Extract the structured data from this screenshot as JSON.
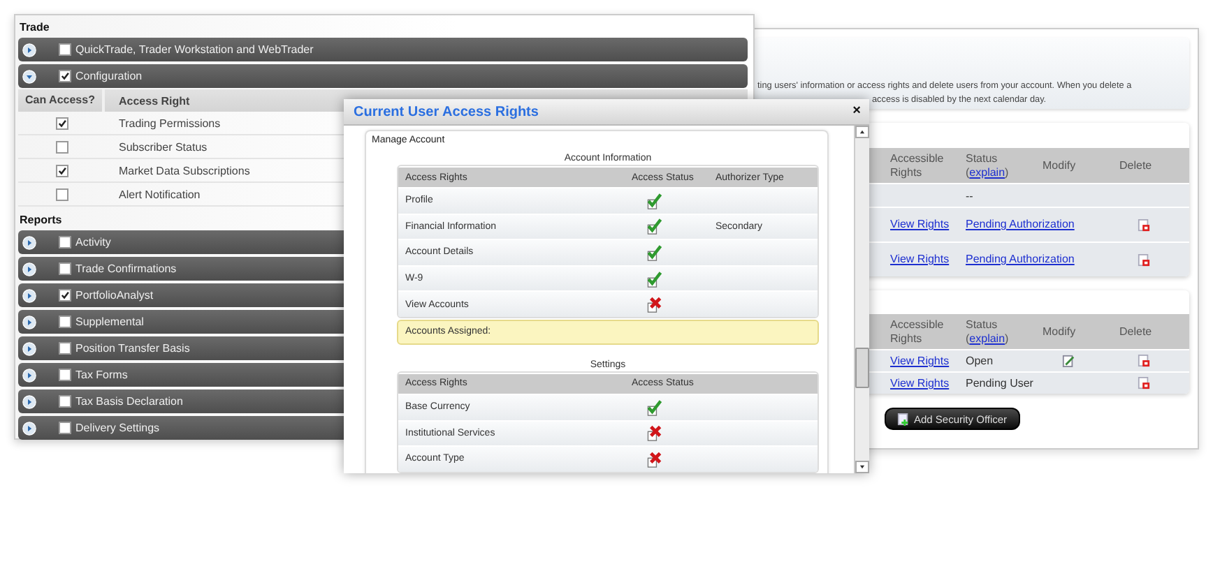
{
  "permissions_panel": {
    "sections": [
      {
        "title": "Trade",
        "groups": [
          {
            "label": "QuickTrade, Trader Workstation and WebTrader",
            "checked": false,
            "expanded": false
          },
          {
            "label": "Configuration",
            "checked": true,
            "expanded": true,
            "columns": [
              "Can Access?",
              "Access Right"
            ],
            "rights": [
              {
                "label": "Trading Permissions",
                "checked": true
              },
              {
                "label": "Subscriber Status",
                "checked": false
              },
              {
                "label": "Market Data Subscriptions",
                "checked": true
              },
              {
                "label": "Alert Notification",
                "checked": false
              }
            ]
          }
        ]
      },
      {
        "title": "Reports",
        "groups": [
          {
            "label": "Activity",
            "checked": false,
            "expanded": false
          },
          {
            "label": "Trade Confirmations",
            "checked": false,
            "expanded": false
          },
          {
            "label": "PortfolioAnalyst",
            "checked": true,
            "expanded": false
          },
          {
            "label": "Supplemental",
            "checked": false,
            "expanded": false
          },
          {
            "label": "Position Transfer Basis",
            "checked": false,
            "expanded": false
          },
          {
            "label": "Tax Forms",
            "checked": false,
            "expanded": false
          },
          {
            "label": "Tax Basis Declaration",
            "checked": false,
            "expanded": false
          },
          {
            "label": "Delivery Settings",
            "checked": false,
            "expanded": false
          }
        ]
      }
    ]
  },
  "users_panel": {
    "intro_lines": [
      "ting users' information or access rights and delete users from your account. When you delete a",
      "access is disabled by the next calendar day."
    ],
    "tables": [
      {
        "columns": [
          {
            "label": "Accessible Rights"
          },
          {
            "label": "Status",
            "link_before": "(",
            "link": "explain",
            "link_after": ")"
          },
          {
            "label": "Modify"
          },
          {
            "label": "Delete"
          }
        ],
        "rows": [
          {
            "status": "--",
            "status_link": false,
            "modify": false,
            "delete": false
          },
          {
            "rights": "View Rights",
            "status": "Pending Authorization",
            "status_link": true,
            "modify": false,
            "delete": true
          },
          {
            "rights": "View Rights",
            "status": "Pending Authorization",
            "status_link": true,
            "modify": false,
            "delete": true
          }
        ]
      },
      {
        "columns": [
          {
            "label": "Accessible Rights"
          },
          {
            "label": "Status",
            "link_before": "(",
            "link": "explain",
            "link_after": ")"
          },
          {
            "label": "Modify"
          },
          {
            "label": "Delete"
          }
        ],
        "rows": [
          {
            "rights": "View Rights",
            "status": "Open",
            "status_link": false,
            "modify": true,
            "delete": true
          },
          {
            "rights": "View Rights",
            "status": "Pending User",
            "status_link": false,
            "modify": false,
            "delete": true
          }
        ]
      }
    ],
    "add_button": "Add Security Officer"
  },
  "dialog": {
    "title": "Current User Access Rights",
    "close": "×",
    "section": "Manage Account",
    "tables": [
      {
        "title": "Account Information",
        "columns": [
          "Access Rights",
          "Access Status",
          "Authorizer Type"
        ],
        "rows": [
          {
            "name": "Profile",
            "granted": true
          },
          {
            "name": "Financial Information",
            "granted": true,
            "authorizer": "Secondary"
          },
          {
            "name": "Account Details",
            "granted": true
          },
          {
            "name": "W-9",
            "granted": true
          },
          {
            "name": "View Accounts",
            "granted": false
          }
        ],
        "note": "Accounts Assigned:"
      },
      {
        "title": "Settings",
        "columns": [
          "Access Rights",
          "Access Status"
        ],
        "rows": [
          {
            "name": "Base Currency",
            "granted": true
          },
          {
            "name": "Institutional Services",
            "granted": false
          },
          {
            "name": "Account Type",
            "granted": false
          }
        ]
      }
    ]
  }
}
